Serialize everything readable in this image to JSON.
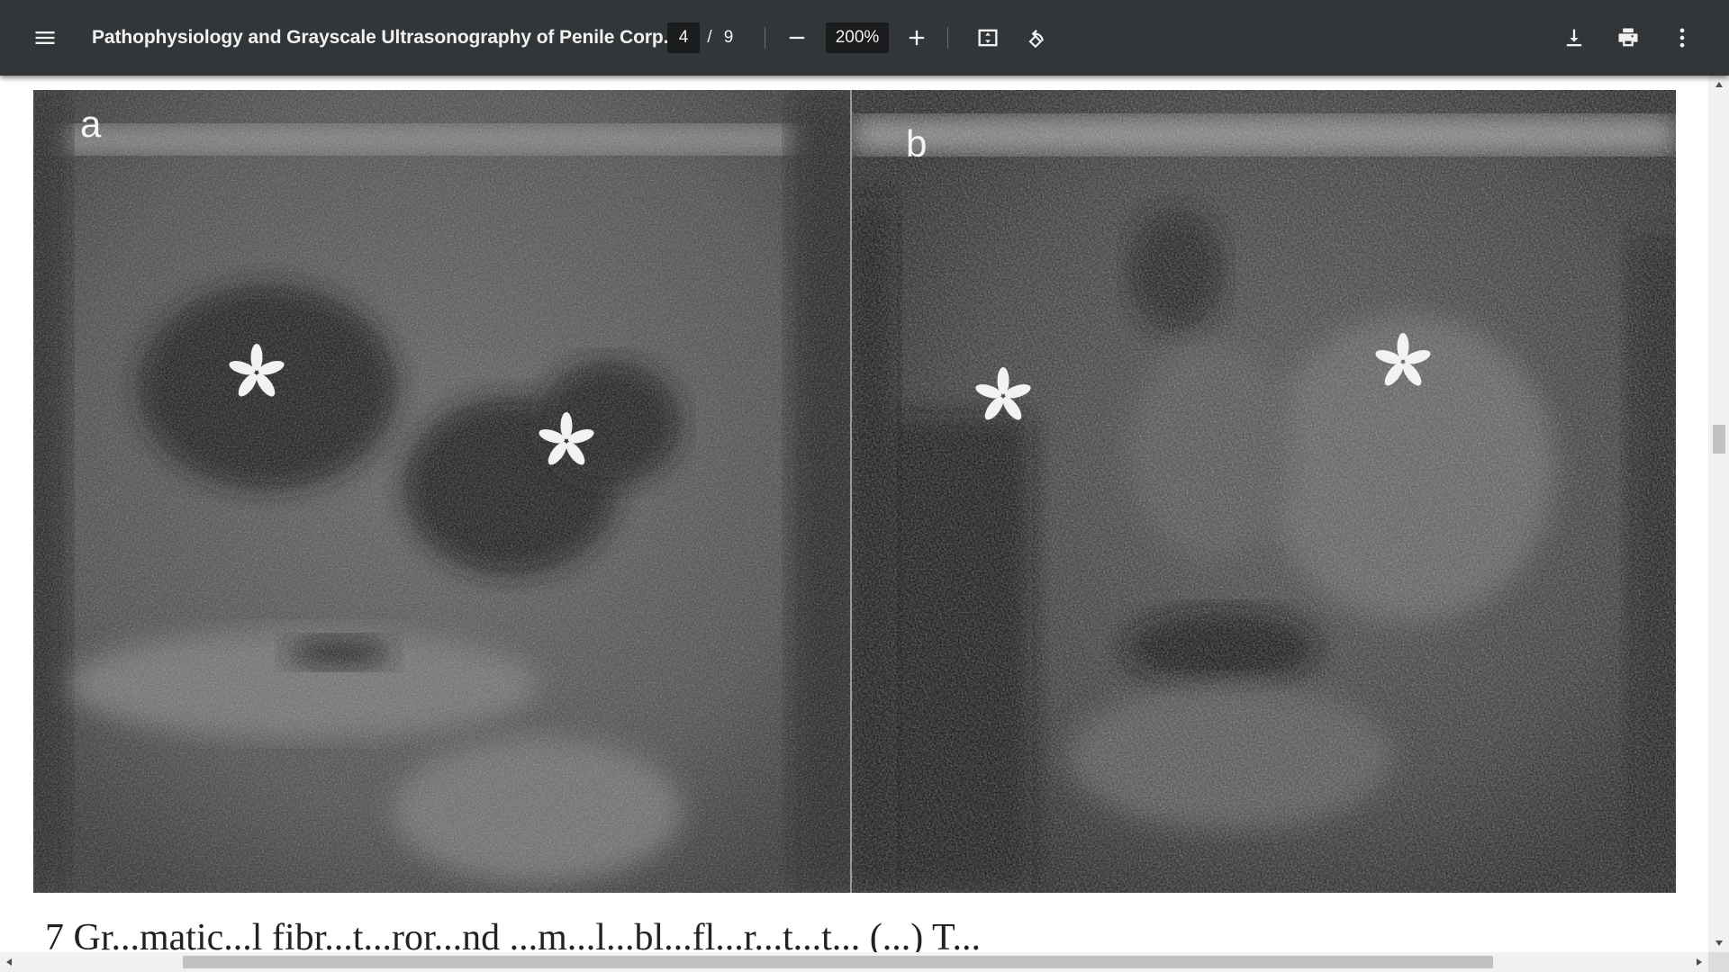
{
  "toolbar": {
    "title": "Pathophysiology and Grayscale Ultrasonography of Penile Corp...",
    "page_current": "4",
    "page_separator": "/",
    "page_total": "9",
    "zoom": "200%",
    "icons": {
      "menu": "menu-icon",
      "zoom_out": "minus-icon",
      "zoom_in": "plus-icon",
      "fit": "fit-to-page-icon",
      "rotate": "rotate-counterclockwise-icon",
      "download": "download-icon",
      "print": "print-icon",
      "more": "more-vertical-icon"
    }
  },
  "document": {
    "figure": {
      "panel_a_label": "a",
      "panel_b_label": "b",
      "marker": "*"
    },
    "cut_off_text": "7  Gr...matic...l fibr...t...ror...nd ...m...l...bl...fl...r...t...t...  (...)  T..."
  },
  "colors": {
    "toolbar_bg": "#323639",
    "viewer_bg": "#525659",
    "scrollbar_track": "#f1f1f1",
    "scrollbar_thumb": "#c1c1c1"
  }
}
